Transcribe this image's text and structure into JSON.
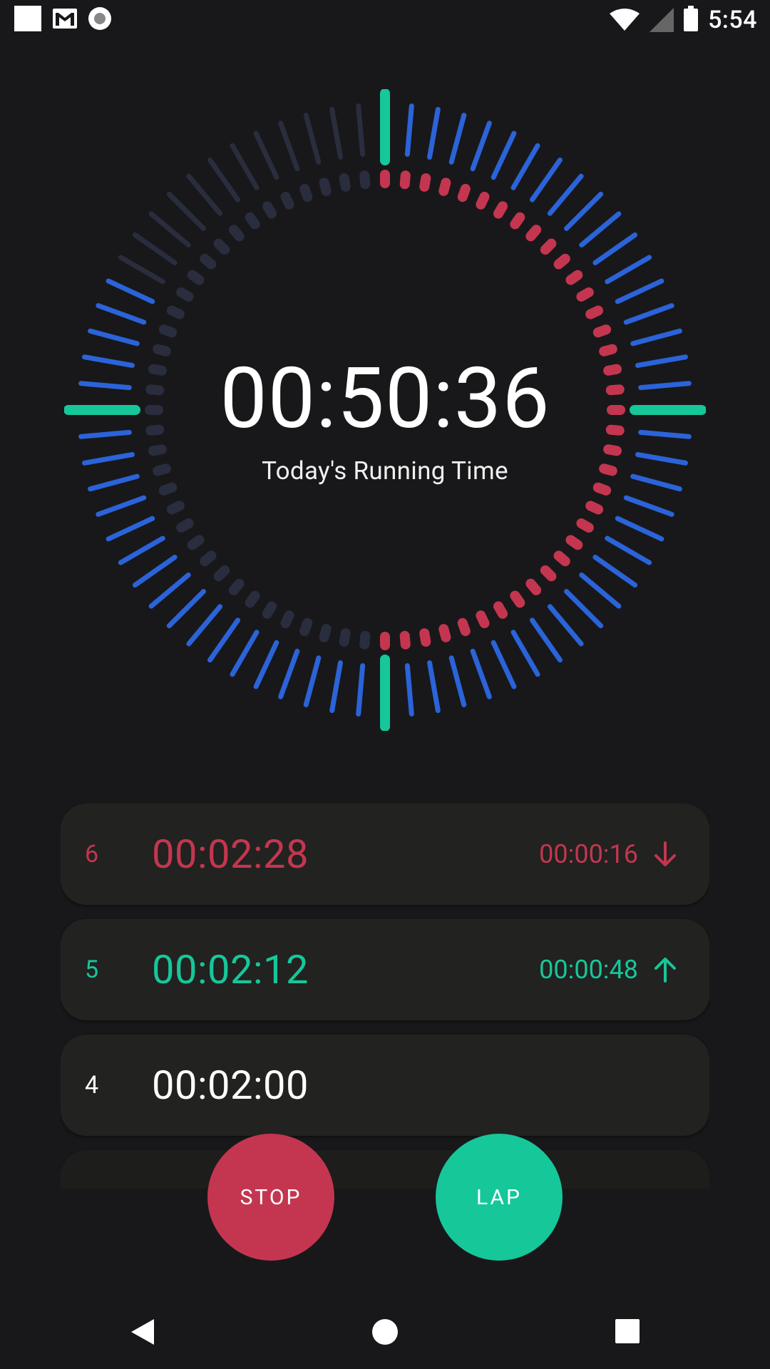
{
  "status_bar": {
    "time": "5:54",
    "icons": [
      "notification-square-icon",
      "gmail-icon",
      "record-icon",
      "wifi-icon",
      "signal-icon",
      "battery-icon"
    ]
  },
  "timer": {
    "elapsed": "00:50:36",
    "label": "Today's Running Time"
  },
  "laps": [
    {
      "number": "6",
      "time": "00:02:28",
      "diff": "00:00:16",
      "trend": "down",
      "color": "#c43650"
    },
    {
      "number": "5",
      "time": "00:02:12",
      "diff": "00:00:48",
      "trend": "up",
      "color": "#16c79a"
    },
    {
      "number": "4",
      "time": "00:02:00",
      "diff": "",
      "trend": "none",
      "color": "#ffffff"
    }
  ],
  "buttons": {
    "stop_label": "STOP",
    "lap_label": "LAP"
  },
  "colors": {
    "background": "#18181a",
    "accent_green": "#16c79a",
    "accent_red": "#c43650",
    "tick_blue": "#2b63d9",
    "tick_dim": "#2a2d3e",
    "card": "#222220"
  },
  "navigation": {
    "icons": [
      "back-icon",
      "home-icon",
      "recents-icon"
    ]
  }
}
